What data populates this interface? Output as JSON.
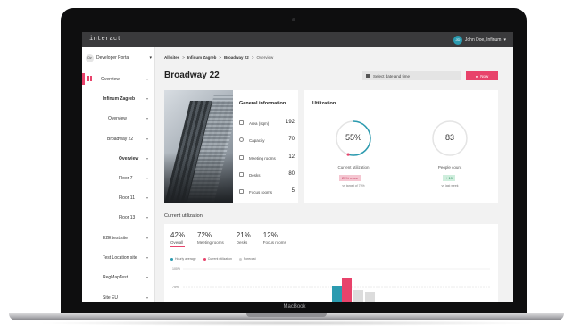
{
  "app": {
    "logo": "interact"
  },
  "user": {
    "initials": "JD",
    "name": "John Doe, Infinum"
  },
  "sidebar": {
    "portal": {
      "badge": "Dv",
      "label": "Developer Portal"
    },
    "items": [
      {
        "label": "Overview"
      },
      {
        "label": "Infinum Zagreb"
      },
      {
        "label": "Overview"
      },
      {
        "label": "Broadway 22"
      },
      {
        "label": "Overview"
      },
      {
        "label": "Floor 7"
      },
      {
        "label": "Floor 11"
      },
      {
        "label": "Floor 13"
      },
      {
        "label": "E2E test site"
      },
      {
        "label": "Test Location site"
      },
      {
        "label": "RegMapTest"
      },
      {
        "label": "Site EU"
      }
    ]
  },
  "breadcrumb": [
    "All sites",
    "Infinum Zagreb",
    "Broadway 22",
    "Overview"
  ],
  "breadcrumb_sep": ">",
  "page": {
    "title": "Broadway 22"
  },
  "date_picker": {
    "placeholder": "Select date and time"
  },
  "now_button": {
    "label": "Now"
  },
  "general": {
    "title": "General information",
    "rows": [
      {
        "label": "Area (sqm)",
        "value": "192"
      },
      {
        "label": "Capacity",
        "value": "70"
      },
      {
        "label": "Meeting rooms",
        "value": "12"
      },
      {
        "label": "Desks",
        "value": "80"
      },
      {
        "label": "Focus rooms",
        "value": "5"
      }
    ]
  },
  "utilization": {
    "title": "Utilization",
    "current": {
      "value": "55%",
      "fraction": 0.55,
      "caption": "Current utilization",
      "badge": "25% more",
      "note": "vs target of 75%"
    },
    "people": {
      "value": "83",
      "caption": "People count",
      "badge": "+ 19",
      "note": "vs last week"
    }
  },
  "current_utilization": {
    "title": "Current utilization",
    "tabs": [
      {
        "pct": "42%",
        "name": "Overall"
      },
      {
        "pct": "72%",
        "name": "Meeting rooms"
      },
      {
        "pct": "21%",
        "name": "Desks"
      },
      {
        "pct": "12%",
        "name": "Focus rooms"
      }
    ],
    "legend": [
      {
        "label": "Hourly average",
        "color": "#2b9bb0"
      },
      {
        "label": "Current utilization",
        "color": "#e8436b"
      },
      {
        "label": "Forecast",
        "color": "#cfcfcf"
      }
    ],
    "axis": [
      "100%",
      "75%"
    ]
  },
  "colors": {
    "accent": "#e8436b",
    "teal": "#2b9bb0",
    "topbar": "#3a3a3c"
  },
  "device": {
    "label": "MacBook"
  }
}
